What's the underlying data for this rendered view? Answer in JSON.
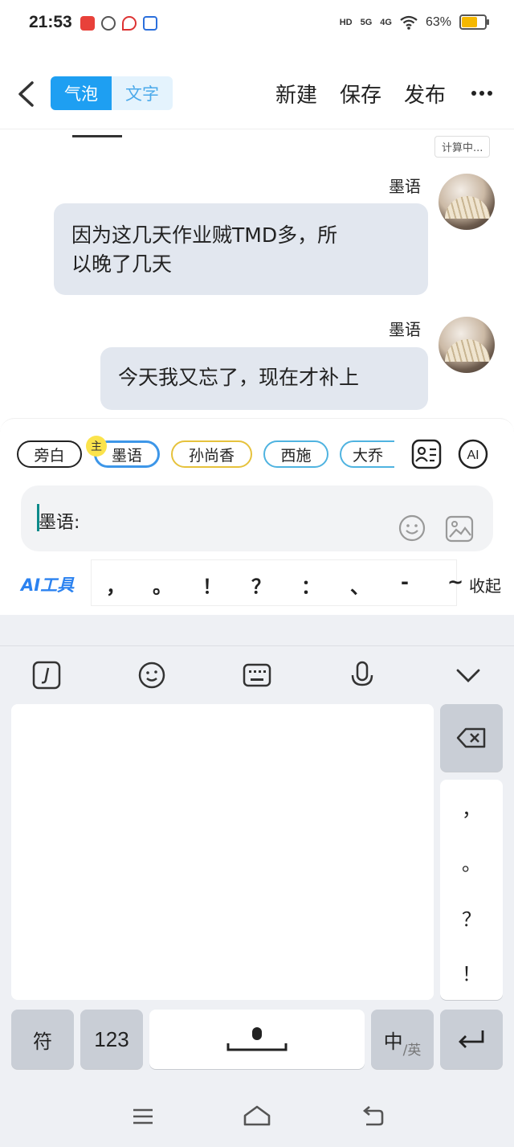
{
  "status_bar": {
    "time": "21:53",
    "hd": "HD",
    "sig1": "5G",
    "sig2": "4G",
    "battery_percent": "63%",
    "battery_level": 0.63
  },
  "header": {
    "back_icon": "chevron-left-icon",
    "mode_tabs": [
      "气泡",
      "文字"
    ],
    "new_label": "新建",
    "save_label": "保存",
    "publish_label": "发布",
    "more_icon": "more-icon"
  },
  "counter_badge": "计算中...",
  "messages": [
    {
      "sender": "墨语",
      "text_line1": "因为这几天作业贼TMD多，所",
      "text_line2": "以晚了几天"
    },
    {
      "sender": "墨语",
      "text_line1": "今天我又忘了，现在才补上"
    }
  ],
  "characters": {
    "main_badge": "主",
    "chips": [
      "旁白",
      "墨语",
      "孙尚香",
      "西施",
      "大乔"
    ]
  },
  "composer": {
    "prefix": "墨语:",
    "ai_tools": "AI工具",
    "punctuation": [
      "，",
      "。",
      "！",
      "？",
      "：",
      "、",
      "-",
      "~"
    ],
    "collapse": "收起"
  },
  "keyboard": {
    "side_keys": [
      "，",
      "。",
      "？",
      "！"
    ],
    "symbol_key": "符",
    "number_key": "123",
    "lang_key_main": "中",
    "lang_key_sub": "/英"
  },
  "colors": {
    "accent": "#1e9ff2",
    "bubble": "#e2e7ef",
    "ai_tools": "#2b82f0",
    "badge": "#fbe34c"
  }
}
